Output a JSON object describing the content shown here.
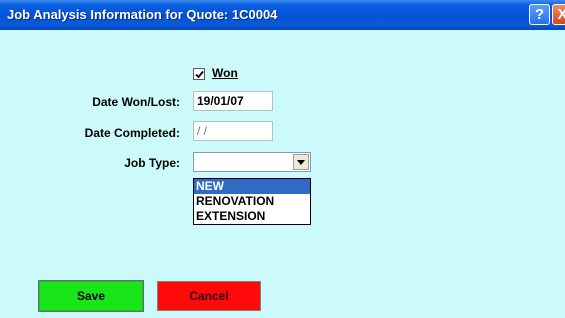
{
  "window": {
    "title": "Job Analysis Information for Quote: 1C0004",
    "help_label": "?",
    "close_label": "X"
  },
  "form": {
    "won": {
      "label": "Won",
      "checked": true
    },
    "date_won_lost": {
      "label": "Date Won/Lost:",
      "value": "19/01/07"
    },
    "date_completed": {
      "label": "Date Completed:",
      "value": " / /"
    },
    "job_type": {
      "label": "Job Type:",
      "value": "",
      "options": [
        "NEW",
        "RENOVATION",
        "EXTENSION"
      ],
      "highlighted": "NEW"
    }
  },
  "buttons": {
    "save_label": "Save",
    "cancel_label": "Cancel"
  },
  "colors": {
    "background": "#ccfafa",
    "save": "#19e619",
    "cancel": "#ff0a0a",
    "selection": "#316ac5"
  }
}
